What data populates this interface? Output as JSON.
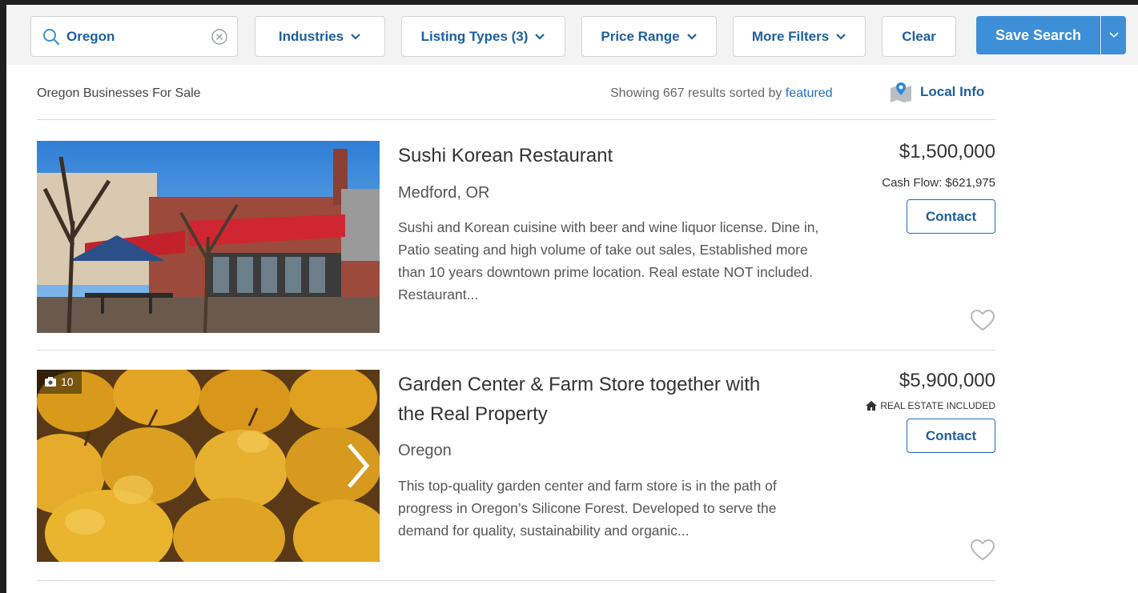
{
  "search": {
    "value": "Oregon",
    "placeholder": ""
  },
  "filters": {
    "industries": "Industries",
    "listing_types": "Listing Types (3)",
    "price_range": "Price Range",
    "more_filters": "More Filters",
    "clear": "Clear",
    "save_search": "Save Search"
  },
  "results": {
    "title": "Oregon Businesses For Sale",
    "showing_prefix": "Showing 667 results sorted by",
    "sort_value": "featured",
    "local_info": "Local Info"
  },
  "listings": [
    {
      "title": "Sushi Korean Restaurant",
      "location": "Medford, OR",
      "description": "Sushi and Korean cuisine with beer and wine liquor license. Dine in, Patio seating and high volume of take out sales, Established more than 10 years downtown prime location. Real estate NOT included. Restaurant...",
      "price": "$1,500,000",
      "sub": "Cash Flow: $621,975",
      "contact": "Contact"
    },
    {
      "title": "Garden Center & Farm Store together with the Real Property",
      "location": "Oregon",
      "description": "This top-quality garden center and farm store is in the path of progress in Oregon’s Silicone Forest. Developed to serve the demand for quality, sustainability and organic...",
      "price": "$5,900,000",
      "sub": "REAL ESTATE INCLUDED",
      "contact": "Contact",
      "photo_count": "10"
    }
  ],
  "colors": {
    "brand_blue": "#1d5f9e",
    "button_blue": "#3d8fd8",
    "link_blue": "#1d6ec3"
  }
}
